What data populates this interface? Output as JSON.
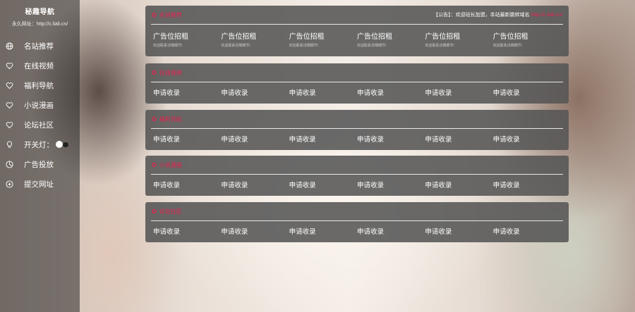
{
  "sidebar": {
    "title": "秘趣导航",
    "url_text": "永久网址：http://c.liali.cn/",
    "items": [
      {
        "label": "名站推荐",
        "icon": "globe-icon"
      },
      {
        "label": "在线视频",
        "icon": "heart-icon"
      },
      {
        "label": "福利导航",
        "icon": "heart-icon"
      },
      {
        "label": "小说漫画",
        "icon": "heart-icon"
      },
      {
        "label": "论坛社区",
        "icon": "heart-icon"
      },
      {
        "label": "开关灯：",
        "icon": "lightbulb-icon"
      },
      {
        "label": "广告投放",
        "icon": "pie-chart-icon"
      },
      {
        "label": "提交网址",
        "icon": "plus-circle-icon"
      }
    ]
  },
  "colors": {
    "accent": "#e8204e",
    "sidebar_bg": "rgba(40,40,40,0.55)",
    "panel_bg": "rgba(85,85,85,0.88)"
  },
  "panels": {
    "featured": {
      "title": "名站推荐",
      "notice": "【公告】：欢迎站长加盟，本站最新跳转域名",
      "notice_domain": "http://c.liali.cn/",
      "ads": [
        {
          "title": "广告位招租",
          "sub": "欢迎联系详细细节!"
        },
        {
          "title": "广告位招租",
          "sub": "欢迎联系详细细节!"
        },
        {
          "title": "广告位招租",
          "sub": "欢迎联系详细细节!"
        },
        {
          "title": "广告位招租",
          "sub": "欢迎联系详细细节!"
        },
        {
          "title": "广告位招租",
          "sub": "欢迎联系详细细节!"
        },
        {
          "title": "广告位招租",
          "sub": "欢迎联系详细细节!"
        }
      ]
    },
    "video": {
      "title": "在线视频",
      "links": [
        "申请收录",
        "申请收录",
        "申请收录",
        "申请收录",
        "申请收录",
        "申请收录"
      ]
    },
    "welfare": {
      "title": "福利导航",
      "links": [
        "申请收录",
        "申请收录",
        "申请收录",
        "申请收录",
        "申请收录",
        "申请收录"
      ]
    },
    "novel": {
      "title": "小说漫画",
      "links": [
        "申请收录",
        "申请收录",
        "申请收录",
        "申请收录",
        "申请收录",
        "申请收录"
      ]
    },
    "forum": {
      "title": "论坛社区",
      "links": [
        "申请收录",
        "申请收录",
        "申请收录",
        "申请收录",
        "申请收录",
        "申请收录"
      ]
    }
  }
}
